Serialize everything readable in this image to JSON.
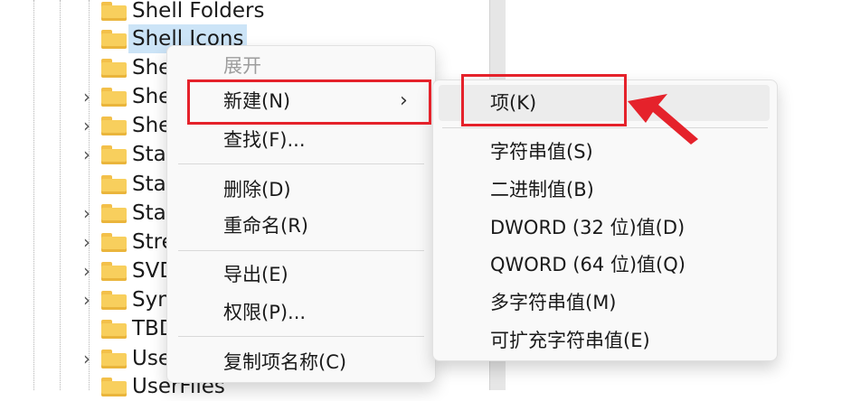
{
  "tree": {
    "items": [
      {
        "label": "Shell Folders",
        "expander": ""
      },
      {
        "label": "Shell Icons",
        "expander": "",
        "selected": true
      },
      {
        "label": "She",
        "expander": ""
      },
      {
        "label": "She",
        "expander": "›"
      },
      {
        "label": "She",
        "expander": "›"
      },
      {
        "label": "Sta",
        "expander": "›"
      },
      {
        "label": "Sta",
        "expander": ""
      },
      {
        "label": "Sta",
        "expander": "›"
      },
      {
        "label": "Stre",
        "expander": "›"
      },
      {
        "label": "SVD",
        "expander": "›"
      },
      {
        "label": "Sym",
        "expander": "›"
      },
      {
        "label": "TBD",
        "expander": ""
      },
      {
        "label": "Use",
        "expander": "›"
      },
      {
        "label": "UserFiles",
        "expander": ""
      }
    ]
  },
  "context_menu": {
    "expand": "展开",
    "new": "新建(N)",
    "find": "查找(F)...",
    "delete": "删除(D)",
    "rename": "重命名(R)",
    "export": "导出(E)",
    "permissions": "权限(P)...",
    "copy_key_name": "复制项名称(C)",
    "submenu_arrow": "›"
  },
  "submenu": {
    "key": "项(K)",
    "string_value": "字符串值(S)",
    "binary_value": "二进制值(B)",
    "dword_value": "DWORD (32 位)值(D)",
    "qword_value": "QWORD (64 位)值(Q)",
    "multi_string_value": "多字符串值(M)",
    "expandable_string_value": "可扩充字符串值(E)"
  },
  "colors": {
    "highlight_box": "#e5222b",
    "selection": "#cce4f7",
    "folder": "#f8cf5d"
  }
}
